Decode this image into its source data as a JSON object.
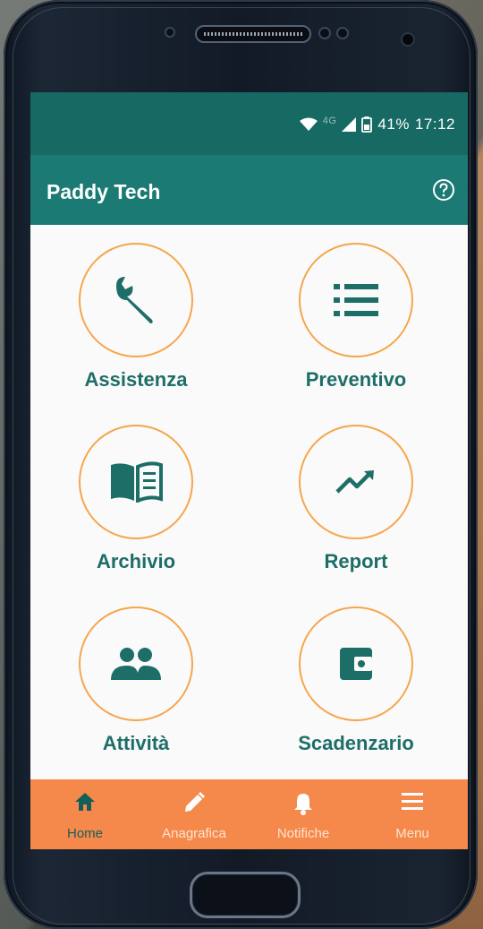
{
  "status": {
    "signal_label": "4G",
    "battery": "41%",
    "time": "17:12"
  },
  "appbar": {
    "title": "Paddy Tech"
  },
  "tiles": [
    {
      "label": "Assistenza",
      "icon": "wrench-icon"
    },
    {
      "label": "Preventivo",
      "icon": "list-icon"
    },
    {
      "label": "Archivio",
      "icon": "book-icon"
    },
    {
      "label": "Report",
      "icon": "trend-icon"
    },
    {
      "label": "Attività",
      "icon": "people-icon"
    },
    {
      "label": "Scadenzario",
      "icon": "wallet-icon"
    }
  ],
  "bottom_nav": [
    {
      "label": "Home",
      "icon": "home-icon",
      "active": true
    },
    {
      "label": "Anagrafica",
      "icon": "pencil-icon",
      "active": false
    },
    {
      "label": "Notifiche",
      "icon": "bell-icon",
      "active": false
    },
    {
      "label": "Menu",
      "icon": "menu-icon",
      "active": false
    }
  ],
  "colors": {
    "primary": "#1b7b74",
    "primary_dark": "#176964",
    "accent": "#f5894b",
    "ring": "#f5a64c",
    "icon": "#1e6e68"
  }
}
